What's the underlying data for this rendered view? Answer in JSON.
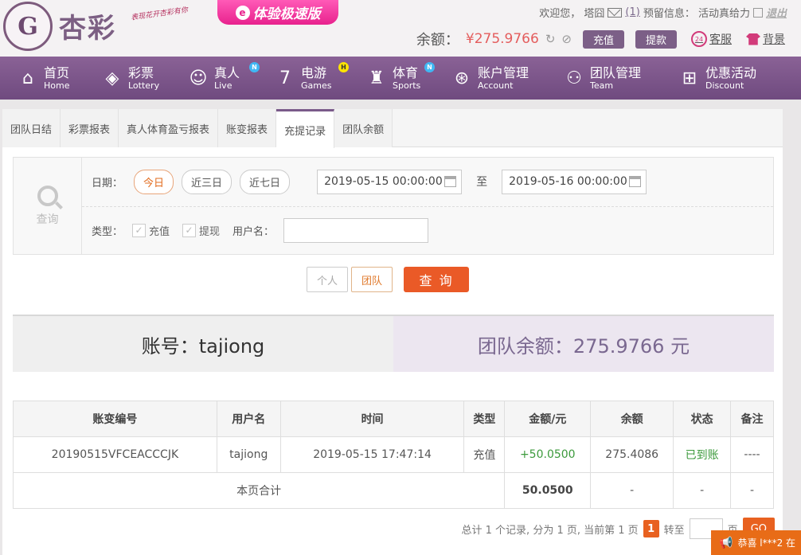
{
  "header": {
    "logo_mark": "G",
    "logo_text": "杏彩",
    "logo_slogan": "表现花开杏彩有你",
    "promo_icon": "e",
    "promo_label": "体验极速版",
    "greeting": "欢迎您， 塔囧",
    "mail_count": "(1)",
    "reserved_info": "预留信息： 活动真给力",
    "logout": "退出",
    "balance_label": "余额：",
    "balance_value": "¥275.9766",
    "refresh_icon": "↻",
    "eye_icon": "⊘",
    "deposit": "充值",
    "withdraw": "提款",
    "service_icon": "24",
    "service": "客服",
    "background": "背景"
  },
  "nav": [
    {
      "zh": "首页",
      "en": "Home",
      "icon": "⌂"
    },
    {
      "zh": "彩票",
      "en": "Lottery",
      "icon": "◈"
    },
    {
      "zh": "真人",
      "en": "Live",
      "icon": "☺",
      "badge": "N"
    },
    {
      "zh": "电游",
      "en": "Games",
      "icon": "7",
      "badge": "H"
    },
    {
      "zh": "体育",
      "en": "Sports",
      "icon": "♜",
      "badge": "N"
    },
    {
      "zh": "账户管理",
      "en": "Account",
      "icon": "⊛"
    },
    {
      "zh": "团队管理",
      "en": "Team",
      "icon": "⚇"
    },
    {
      "zh": "优惠活动",
      "en": "Discount",
      "icon": "⊞"
    }
  ],
  "tabs": [
    "团队日结",
    "彩票报表",
    "真人体育盈亏报表",
    "账变报表",
    "充提记录",
    "团队余额"
  ],
  "filter": {
    "query_label": "查询",
    "date_label": "日期：",
    "quick": [
      "今日",
      "近三日",
      "近七日"
    ],
    "start": "2019-05-15 00:00:00",
    "to": "至",
    "end": "2019-05-16 00:00:00",
    "type_label": "类型：",
    "types": [
      "充值",
      "提现"
    ],
    "check": "✓",
    "username_label": "用户名："
  },
  "actions": {
    "personal": "个人",
    "team": "团队",
    "query": "查 询"
  },
  "summary": {
    "account": "账号：tajiong",
    "team_balance": "团队余额：275.9766 元"
  },
  "table": {
    "headers": [
      "账变编号",
      "用户名",
      "时间",
      "类型",
      "金额/元",
      "余额",
      "状态",
      "备注"
    ],
    "rows": [
      [
        "20190515VFCEACCCJK",
        "tajiong",
        "2019-05-15 17:47:14",
        "充值",
        "+50.0500",
        "275.4086",
        "已到账",
        "----"
      ]
    ],
    "total": {
      "label": "本页合计",
      "amount": "50.0500",
      "balance": "-",
      "status": "-",
      "note": "-"
    }
  },
  "pager": {
    "info": "总计 1 个记录, 分为 1 页, 当前第 1 页",
    "current": "1",
    "goto_label": "转至",
    "page_unit": "页",
    "go": "GO"
  },
  "toast": {
    "icon": "📢",
    "text": "恭喜 l***2 在"
  }
}
